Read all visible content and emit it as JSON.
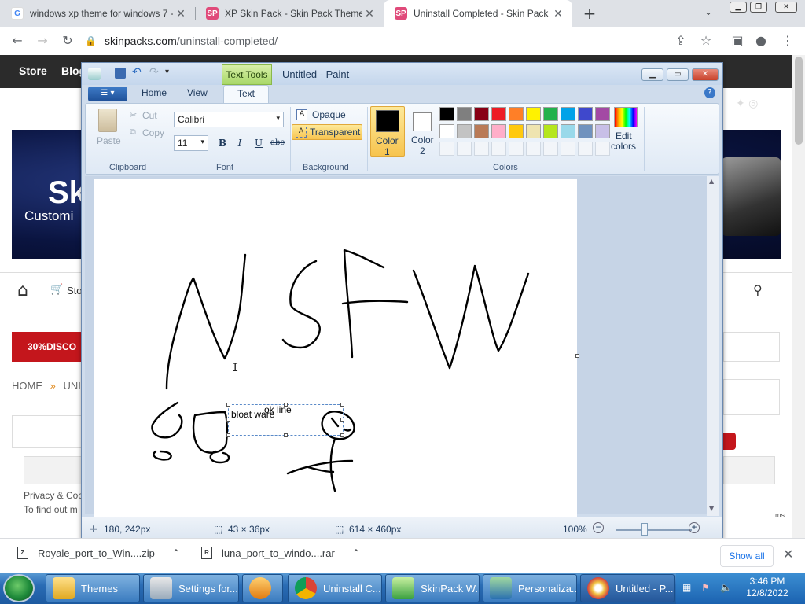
{
  "browser": {
    "tabs": [
      {
        "title": "windows xp theme for windows 7 -",
        "icon": "google-icon"
      },
      {
        "title": "XP Skin Pack - Skin Pack Theme for",
        "icon": "skinpack-icon"
      },
      {
        "title": "Uninstall Completed - Skin Pack The",
        "icon": "skinpack-icon"
      }
    ],
    "url_host": "skinpacks.com",
    "url_path": "/uninstall-completed/"
  },
  "site": {
    "nav": [
      "Store",
      "Blog"
    ],
    "banner_big": "Sk",
    "banner_sub": "Customi",
    "shop_label": "Sto",
    "promo": "30%DISCO",
    "breadcrumb_home": "HOME",
    "breadcrumb_sep": "»",
    "breadcrumb_current": "UNI",
    "privacy_line1": "Privacy & Coo",
    "privacy_line2": "To find out m",
    "right_note": "ms"
  },
  "paint": {
    "title": "Untitled - Paint",
    "contextual_tab": "Text Tools",
    "tabs": [
      "Home",
      "View",
      "Text"
    ],
    "clipboard": {
      "paste": "Paste",
      "cut": "Cut",
      "copy": "Copy",
      "group": "Clipboard"
    },
    "font": {
      "family": "Calibri",
      "size": "11",
      "bold": "B",
      "italic": "I",
      "underline": "U",
      "strike": "abc",
      "group": "Font"
    },
    "background": {
      "opaque": "Opaque",
      "transparent": "Transparent",
      "group": "Background"
    },
    "colors": {
      "color1_label": "Color",
      "color1_num": "1",
      "color2_label": "Color",
      "color2_num": "2",
      "edit_label": "Edit",
      "edit_label2": "colors",
      "group": "Colors",
      "palette_row1": [
        "#000000",
        "#7f7f7f",
        "#880015",
        "#ed1c24",
        "#ff7f27",
        "#fff200",
        "#22b14c",
        "#00a2e8",
        "#3f48cc",
        "#a349a4"
      ],
      "palette_row2": [
        "#ffffff",
        "#c3c3c3",
        "#b97a57",
        "#ffaec9",
        "#ffc90e",
        "#efe4b0",
        "#b5e61d",
        "#99d9ea",
        "#7092be",
        "#c8bfe7"
      ],
      "color1_value": "#000000",
      "color2_value": "#ffffff"
    },
    "canvas_text": {
      "line1": "ok  line",
      "line2": "bloat ware"
    },
    "status": {
      "cursor": "180, 242px",
      "selection": "43 × 36px",
      "image_size": "614 × 460px",
      "zoom": "100%"
    }
  },
  "downloads": [
    {
      "name": "Royale_port_to_Win....zip",
      "icon": "zip-icon"
    },
    {
      "name": "luna_port_to_windo....rar",
      "icon": "rar-icon"
    }
  ],
  "downloads_show_all": "Show all",
  "taskbar": {
    "items": [
      "Themes",
      "Settings for...",
      "",
      "Uninstall C...",
      "SkinPack W...",
      "Personaliza...",
      "Untitled - P..."
    ],
    "time": "3:46 PM",
    "date": "12/8/2022"
  }
}
